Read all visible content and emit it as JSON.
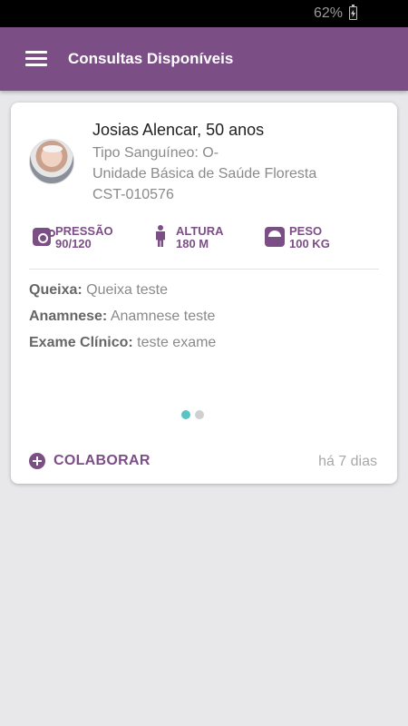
{
  "status_bar": {
    "battery_percent": "62%"
  },
  "app_bar": {
    "title": "Consultas Disponíveis"
  },
  "card": {
    "patient_name": "Josias Alencar, 50 anos",
    "blood_type": "Tipo Sanguíneo: O-",
    "health_unit": "Unidade Básica de Saúde Floresta",
    "code": "CST-010576",
    "vitals": [
      {
        "label": "PRESSÃO",
        "value": "90/120",
        "icon": "blood-pressure-icon"
      },
      {
        "label": "ALTURA",
        "value": "180 M",
        "icon": "person-height-icon"
      },
      {
        "label": "PESO",
        "value": "100 KG",
        "icon": "scale-icon"
      }
    ],
    "details": [
      {
        "label": "Queixa:",
        "value": "Queixa teste"
      },
      {
        "label": "Anamnese:",
        "value": "Anamnese teste"
      },
      {
        "label": "Exame Clínico:",
        "value": "teste exame"
      }
    ],
    "pagination": {
      "current_page": 1,
      "total_pages": 2
    },
    "collaborate_label": "COLABORAR",
    "time_ago": "há 7 dias"
  },
  "colors": {
    "primary": "#7b4f86",
    "accent": "#5bc3c6"
  }
}
